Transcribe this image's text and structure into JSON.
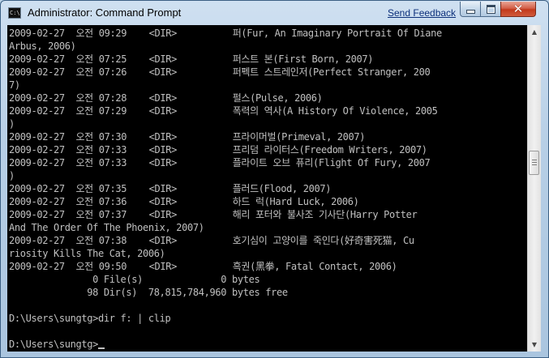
{
  "window": {
    "title": "Administrator: Command Prompt",
    "feedback_link": "Send Feedback",
    "icon_label": "C:\\",
    "icons": {
      "app": "console-icon",
      "minimize": "minimize-icon",
      "maximize": "maximize-icon",
      "close": "close-icon"
    },
    "close_glyph": "✕"
  },
  "scrollbar": {
    "up_arrow": "▲",
    "down_arrow": "▼"
  },
  "console": {
    "lines": [
      "2009-02-27  오전 09:29    <DIR>          퍼(Fur, An Imaginary Portrait Of Diane",
      "Arbus, 2006)",
      "2009-02-27  오전 07:25    <DIR>          퍼스트 본(First Born, 2007)",
      "2009-02-27  오전 07:26    <DIR>          퍼펙트 스트레인저(Perfect Stranger, 200",
      "7)",
      "2009-02-27  오전 07:28    <DIR>          펄스(Pulse, 2006)",
      "2009-02-27  오전 07:29    <DIR>          폭력의 역사(A History Of Violence, 2005",
      ")",
      "2009-02-27  오전 07:30    <DIR>          프라이머벌(Primeval, 2007)",
      "2009-02-27  오전 07:33    <DIR>          프리덤 라이터스(Freedom Writers, 2007)",
      "2009-02-27  오전 07:33    <DIR>          플라이트 오브 퓨리(Flight Of Fury, 2007",
      ")",
      "2009-02-27  오전 07:35    <DIR>          플러드(Flood, 2007)",
      "2009-02-27  오전 07:36    <DIR>          하드 럭(Hard Luck, 2006)",
      "2009-02-27  오전 07:37    <DIR>          해리 포터와 불사조 기사단(Harry Potter",
      "And The Order Of The Phoenix, 2007)",
      "2009-02-27  오전 07:38    <DIR>          호기심이 고양이를 죽인다(好奇害死猫, Cu",
      "riosity Kills The Cat, 2006)",
      "2009-02-27  오전 09:50    <DIR>          흑권(黑拳, Fatal Contact, 2006)",
      "               0 File(s)              0 bytes",
      "              98 Dir(s)  78,815,784,960 bytes free",
      "",
      "D:\\Users\\sungtg>dir f: | clip",
      "",
      "D:\\Users\\sungtg>"
    ]
  }
}
